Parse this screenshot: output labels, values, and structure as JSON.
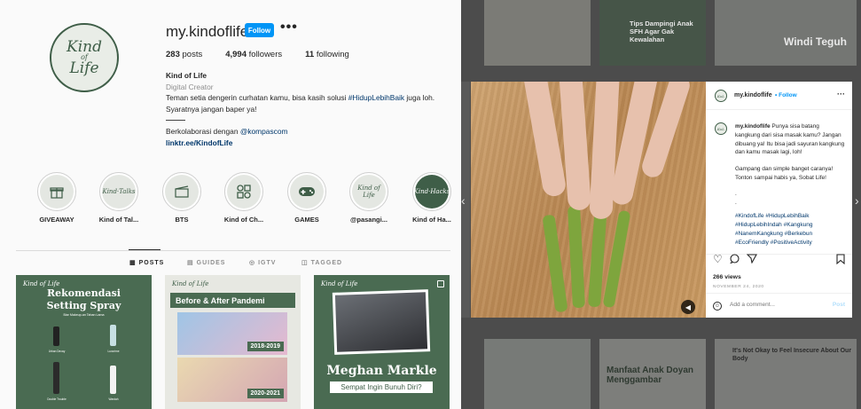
{
  "profile": {
    "username": "my.kindoflife",
    "follow_label": "Follow",
    "more_label": "•••",
    "avatar_line1": "Kind",
    "avatar_line2": "of",
    "avatar_line3": "Life",
    "stats": {
      "posts_count": "283",
      "posts_label": "posts",
      "followers_count": "4,994",
      "followers_label": "followers",
      "following_count": "11",
      "following_label": "following"
    },
    "bio": {
      "name": "Kind of Life",
      "category": "Digital Creator",
      "line1_prefix": "Teman setia dengerin curhatan kamu, bisa kasih solusi ",
      "line1_hashtag": "#HidupLebihBaik",
      "line1_suffix": " juga loh.",
      "line2": "Syaratnya jangan baper ya!",
      "collab_prefix": "Berkolaborasi dengan ",
      "collab_mention": "@kompascom",
      "link": "linktr.ee/KindofLife"
    }
  },
  "highlights": [
    {
      "label": "GIVEAWAY",
      "icon": "gift-icon"
    },
    {
      "label": "Kind of Tal...",
      "icon": "kind-of-talks-logo"
    },
    {
      "label": "BTS",
      "icon": "clapperboard-icon"
    },
    {
      "label": "Kind of Ch...",
      "icon": "grid-shapes-icon"
    },
    {
      "label": "GAMES",
      "icon": "gamepad-icon"
    },
    {
      "label": "@pasangi...",
      "icon": "kind-of-life-logo"
    },
    {
      "label": "Kind of Ha...",
      "icon": "kind-of-hacks-logo"
    }
  ],
  "tabs": [
    {
      "label": "POSTS",
      "icon": "grid-icon",
      "active": true
    },
    {
      "label": "GUIDES",
      "icon": "guides-icon",
      "active": false
    },
    {
      "label": "IGTV",
      "icon": "igtv-icon",
      "active": false
    },
    {
      "label": "TAGGED",
      "icon": "tagged-icon",
      "active": false
    }
  ],
  "posts": {
    "p1_brand": "Kind of Life",
    "p1_title_line1": "Rekomendasi",
    "p1_title_line2": "Setting Spray",
    "p1_sub": "Biar Makeup-an Tahan Lama",
    "p1_products": [
      "Urban Decay",
      "Luxcrime",
      "Double Trouble",
      "Wardah"
    ],
    "p2_brand": "Kind of Life",
    "p2_title": "Before & After Pandemi",
    "p2_year1": "2018-2019",
    "p2_year2": "2020-2021",
    "p3_brand": "Kind of Life",
    "p3_title": "Meghan Markle",
    "p3_sub": "Sempat Ingin Bunuh Diri?"
  },
  "background_tiles": {
    "t1": "Tips Dampingi Anak SFH Agar Gak Kewalahan",
    "t2": "Windi Teguh",
    "t3": "Manfaat Anak Doyan Menggambar",
    "t4": "It's Not Okay to Feel Insecure About Our Body"
  },
  "modal": {
    "username": "my.kindoflife",
    "follow_label": "Follow",
    "caption_user": "my.kindoflife",
    "caption_text": "Punya sisa batang kangkung dari sisa masak kamu? Jangan dibuang ya! Itu bisa jadi sayuran kangkung dan kamu masak lagi, loh!",
    "caption_text2": "Gampang dan simple banget caranya! Tonton sampai habis ya, Sobat Life!",
    "dots": ".\n.",
    "hashtags": "#KindofLife #HidupLebihBaik #HidupLebihIndah #Kangkung #NanemKangkung #Berkebun #EcoFriendly #PositiveActivity",
    "views": "266 views",
    "date": "NOVEMBER 24, 2020",
    "comment_placeholder": "Add a comment...",
    "post_label": "Post"
  }
}
